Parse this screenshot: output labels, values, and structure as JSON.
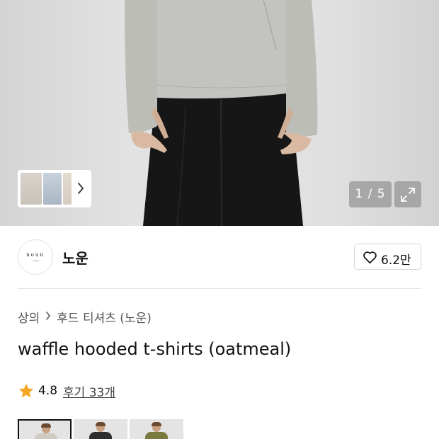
{
  "gallery": {
    "counter": "1 / 5",
    "thumb_chevron_icon": "chevron-right-icon",
    "expand_icon": "expand-arrows-icon"
  },
  "brand": {
    "logo_text": "noun",
    "name": "노운",
    "like_count": "6.2만",
    "like_icon": "heart-outline-icon"
  },
  "breadcrumb": {
    "items": [
      "상의",
      "후드 티셔츠 (노운)"
    ],
    "separator_icon": "chevron-right-icon"
  },
  "product": {
    "title": "waffle hooded t-shirts (oatmeal)"
  },
  "rating": {
    "score": "4.8",
    "reviews": "후기 33개",
    "star_color": "#f5a623",
    "star_icon": "star-icon"
  },
  "variants": [
    {
      "color": "#cfcac2",
      "selected": true
    },
    {
      "color": "#2e2e2e",
      "selected": false
    },
    {
      "color": "#7a7a3e",
      "selected": false
    }
  ]
}
